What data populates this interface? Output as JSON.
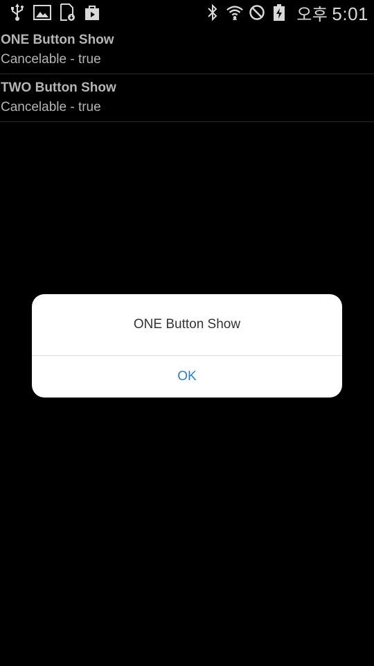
{
  "status_bar": {
    "left_icons": [
      "usb-icon",
      "image-icon",
      "download-icon",
      "shopping-bag-icon"
    ],
    "right_icons": [
      "bluetooth-icon",
      "wifi-icon",
      "no-sim-icon",
      "battery-charging-icon"
    ],
    "ampm": "오후",
    "time": "5:01",
    "icon_color": "#d8d8d8"
  },
  "list": {
    "items": [
      {
        "title": "ONE Button Show",
        "subtitle": "Cancelable - true"
      },
      {
        "title": "TWO Button Show",
        "subtitle": "Cancelable - true"
      }
    ]
  },
  "dialog": {
    "message": "ONE Button Show",
    "ok_label": "OK",
    "button_color": "#2a7fd4"
  }
}
